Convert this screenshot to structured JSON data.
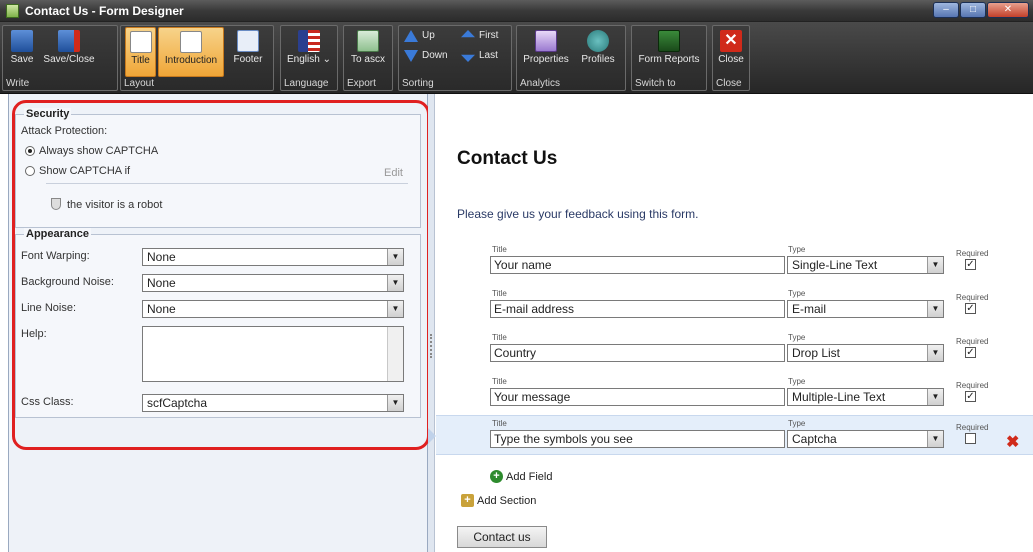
{
  "window": {
    "title": "Contact Us - Form Designer",
    "controls": [
      "–",
      "□",
      "✕"
    ]
  },
  "ribbon": {
    "groups": [
      {
        "label": "Write",
        "buttons": [
          "Save",
          "Save/Close"
        ]
      },
      {
        "label": "Layout",
        "buttons": [
          "Title",
          "Introduction",
          "Footer"
        ]
      },
      {
        "label": "Language",
        "buttons": [
          "English ⌄"
        ]
      },
      {
        "label": "Export",
        "buttons": [
          "To ascx"
        ]
      },
      {
        "label": "Sorting",
        "buttons": [
          "Up",
          "Down",
          "First",
          "Last"
        ]
      },
      {
        "label": "Analytics",
        "buttons": [
          "Properties",
          "Profiles"
        ]
      },
      {
        "label": "Switch to",
        "buttons": [
          "Form Reports"
        ]
      },
      {
        "label": "Close",
        "buttons": [
          "Close"
        ]
      }
    ],
    "active_layout": "Introduction",
    "colors": {
      "active": "#f0a637"
    }
  },
  "security": {
    "legend": "Security",
    "attack_label": "Attack Protection:",
    "option_always": "Always show CAPTCHA",
    "option_if": "Show CAPTCHA if",
    "edit_link": "Edit",
    "condition": "the visitor is a robot",
    "selected": "always"
  },
  "appearance": {
    "legend": "Appearance",
    "font_warping_label": "Font Warping:",
    "font_warping_value": "None",
    "background_noise_label": "Background Noise:",
    "background_noise_value": "None",
    "line_noise_label": "Line Noise:",
    "line_noise_value": "None",
    "help_label": "Help:",
    "css_label": "Css Class:",
    "css_value": "scfCaptcha"
  },
  "form": {
    "title": "Contact Us",
    "introduction": "Please give us your feedback using this form.",
    "col_title": "Title",
    "col_type": "Type",
    "col_required": "Required",
    "fields": [
      {
        "title": "Your name",
        "type": "Single-Line Text",
        "required": true
      },
      {
        "title": "E-mail address",
        "type": "E-mail",
        "required": true
      },
      {
        "title": "Country",
        "type": "Drop List",
        "required": true
      },
      {
        "title": "Your message",
        "type": "Multiple-Line Text",
        "required": true
      },
      {
        "title": "Type the symbols you see",
        "type": "Captcha",
        "required": false
      }
    ],
    "selected_field": 4,
    "add_field": "Add Field",
    "add_section": "Add Section",
    "submit": "Contact us"
  }
}
